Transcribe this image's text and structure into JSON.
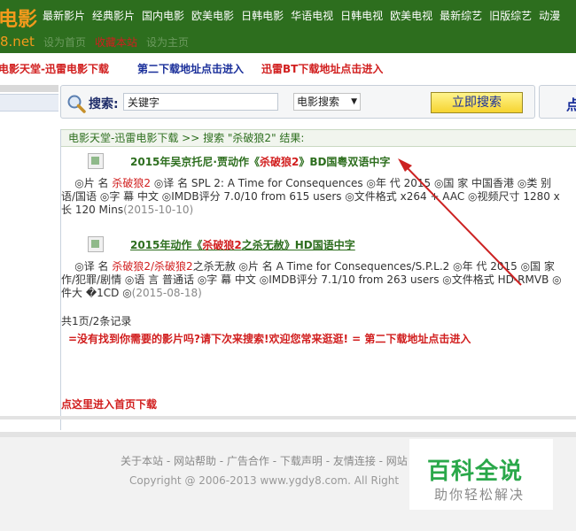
{
  "header": {
    "logo_main": "电影",
    "logo_sub": "8.net",
    "nav": [
      "最新影片",
      "经典影片",
      "国内电影",
      "欧美电影",
      "日韩电影",
      "华语电视",
      "日韩电视",
      "欧美电视",
      "最新综艺",
      "旧版综艺",
      "动漫"
    ],
    "subnav": [
      {
        "label": "设为首页",
        "style": "faded"
      },
      {
        "label": "收藏本站",
        "style": "bright"
      },
      {
        "label": "设为主页",
        "style": "faded"
      }
    ]
  },
  "linkbar": {
    "link1": "电影天堂-迅雷电影下载",
    "link2": "第二下载地址点击进入",
    "link3": "迅雷BT下载地址点击进入"
  },
  "search": {
    "label": "搜索:",
    "value": "关键字",
    "select_value": "电影搜索",
    "button": "立即搜索",
    "right_box_text": "点"
  },
  "results": {
    "crumb_home": "电影天堂-迅雷电影下载",
    "crumb_sep": " >> ",
    "crumb_rest": "搜索 \"杀破狼2\" 结果:",
    "items": [
      {
        "title_pre": "2015年吴京托尼·贾动作《",
        "title_kw": "杀破狼2",
        "title_post": "》BD国粤双语中字",
        "desc_line1_pre": "    ◎片 名 ",
        "desc_line1_kw": "杀破狼2",
        "desc_line1_post": " ◎译 名 SPL 2: A Time for Consequences ◎年 代 2015 ◎国 家 中国香港 ◎类 别",
        "desc_line2": "语/国语 ◎字 幕 中文 ◎IMDB评分 7.0/10 from 615 users ◎文件格式 x264 + AAC ◎视频尺寸 1280 x",
        "desc_line3_pre": "长 120 Mins",
        "desc_date": "(2015-10-10)"
      },
      {
        "title_pre": "2015年动作《",
        "title_kw": "杀破狼2",
        "title_post": "之杀无赦》HD国语中字",
        "desc_line1_pre": "    ◎译 名 ",
        "desc_line1_kw": "杀破狼2/杀破狼2",
        "desc_line1_post": "之杀无赦 ◎片 名 A Time for Consequences/S.P.L.2 ◎年 代 2015 ◎国 家",
        "desc_line2": "作/犯罪/剧情 ◎语 言 普通话 ◎字 幕 中文 ◎IMDB评分 7.1/10 from 263 users ◎文件格式 HD-RMVB ◎",
        "desc_line3_pre": "件大 �1CD ◎",
        "desc_date": "(2015-08-18)"
      }
    ],
    "paging": "共1页/2条记录",
    "notice": "=没有找到你需要的影片吗?请下次来搜索!欢迎您常来逛逛! = 第二下载地址点击进入",
    "bottom_link": "点这里进入首页下载"
  },
  "footer": {
    "links": "关于本站 - 网站帮助 - 广告合作 - 下载声明 - 友情连接 - 网站",
    "copyright": "Copyright @ 2006-2013 www.ygdy8.com. All Right"
  },
  "watermark": {
    "main": "百科全说",
    "sub": "助你轻松解决"
  },
  "colors": {
    "header_green": "#2d6e1e",
    "logo_orange": "#f39a1c",
    "link_red": "#d11e1e",
    "link_blue": "#1a2f9a",
    "button_yellow": "#f6d430",
    "annotation_arrow": "#cc2222"
  }
}
